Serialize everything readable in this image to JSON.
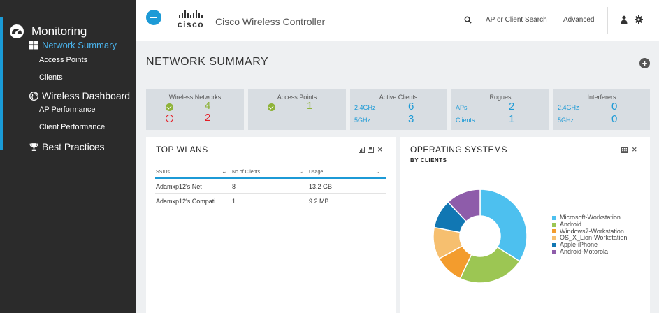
{
  "sidebar": {
    "heading": "Monitoring",
    "heading_icon": "dashboard-icon",
    "network_summary": "Network Summary",
    "access_points": "Access Points",
    "clients": "Clients",
    "wireless_dashboard": "Wireless Dashboard",
    "ap_performance": "AP Performance",
    "client_performance": "Client Performance",
    "best_practices": "Best Practices"
  },
  "topbar": {
    "logo_text": "cisco",
    "title": "Cisco Wireless Controller",
    "search_label": "AP or Client Search",
    "advanced_label": "Advanced"
  },
  "page": {
    "title": "NETWORK SUMMARY"
  },
  "tiles": {
    "wireless_networks": {
      "label": "Wireless Networks",
      "enabled": "4",
      "disabled": "2"
    },
    "access_points": {
      "label": "Access Points",
      "count": "1"
    },
    "active_clients": {
      "label": "Active Clients",
      "band1": "2.4GHz",
      "band1_value": "6",
      "band2": "5GHz",
      "band2_value": "3"
    },
    "rogues": {
      "label": "Rogues",
      "aps_label": "APs",
      "aps_value": "2",
      "clients_label": "Clients",
      "clients_value": "1"
    },
    "interferers": {
      "label": "Interferers",
      "band1": "2.4GHz",
      "band1_value": "0",
      "band2": "5GHz",
      "band2_value": "0"
    }
  },
  "top_wlans": {
    "title": "TOP WLANS",
    "columns": [
      "SSIDs",
      "No of Clients",
      "Usage"
    ],
    "rows": [
      {
        "ssid": "Adamxp12's Net",
        "clients": "8",
        "usage": "13.2 GB"
      },
      {
        "ssid": "Adamxp12's Compati…",
        "clients": "1",
        "usage": "9.2 MB"
      }
    ]
  },
  "os_panel": {
    "title": "OPERATING SYSTEMS",
    "subtitle": "BY CLIENTS"
  },
  "chart_data": {
    "type": "pie",
    "donut": true,
    "legend_position": "right",
    "series": [
      {
        "name": "Microsoft-Workstation",
        "value": 34,
        "color": "#4dc0ef"
      },
      {
        "name": "Android",
        "value": 23,
        "color": "#9cc653"
      },
      {
        "name": "Windows7-Workstation",
        "value": 10,
        "color": "#f39c2d"
      },
      {
        "name": "OS_X_Lion-Workstation",
        "value": 11,
        "color": "#f6bf6f"
      },
      {
        "name": "Apple-iPhone",
        "value": 10,
        "color": "#1177b3"
      },
      {
        "name": "Android-Motorola",
        "value": 12,
        "color": "#8e5caa"
      }
    ]
  },
  "colors": {
    "accent": "#1c9ad6",
    "sidebar_bg": "#2b2b2b",
    "ok": "#8fb33a",
    "alert": "#e41e26"
  }
}
